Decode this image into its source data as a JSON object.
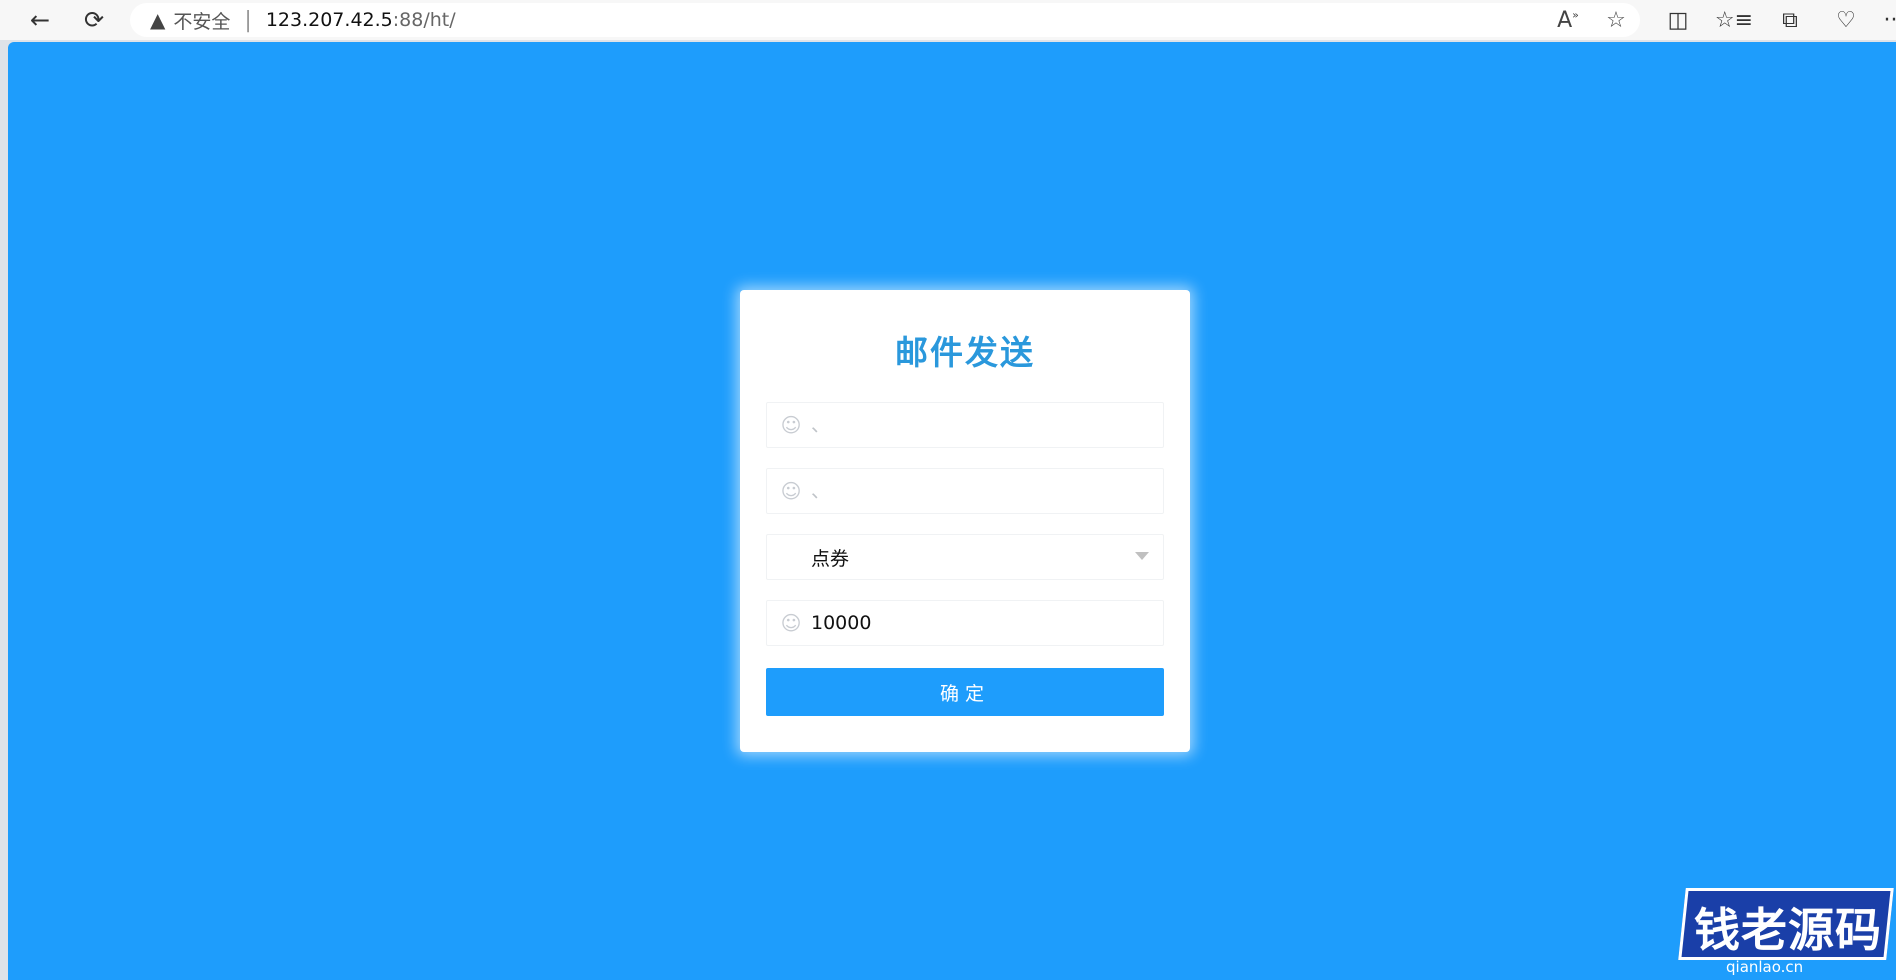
{
  "browser": {
    "security_label": "不安全",
    "url_host": "123.207.42.5",
    "url_rest": ":88/ht/",
    "icons": {
      "back": "back-arrow-icon",
      "reload": "reload-icon",
      "warning": "warning-icon",
      "read_aloud": "read-aloud-icon",
      "favorite": "star-icon",
      "split_screen": "split-screen-icon",
      "favorites": "favorites-icon",
      "collections": "collections-icon",
      "performance": "heart-pulse-icon",
      "more": "more-icon"
    }
  },
  "form": {
    "title": "邮件发送",
    "field1_placeholder": "、",
    "field2_placeholder": "、",
    "select_value": "点券",
    "amount_value": "10000",
    "submit_label": "确定"
  },
  "watermark": {
    "text": "钱老源码",
    "sub": "qianlao.cn"
  },
  "colors": {
    "page_bg": "#1e9dfc",
    "title": "#2a98dc",
    "button": "#1e9dfc",
    "card": "#ffffff"
  }
}
